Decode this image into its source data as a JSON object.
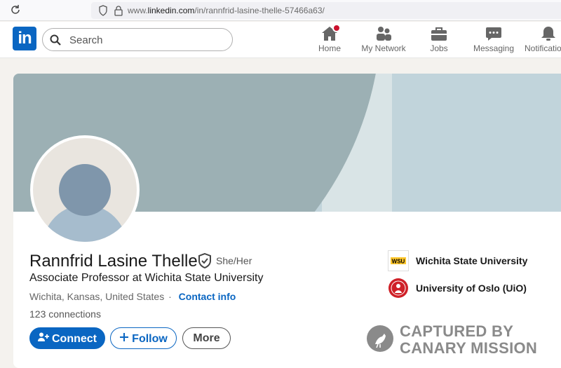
{
  "browser": {
    "url_prefix": "www.",
    "url_domain": "linkedin.com",
    "url_path": "/in/rannfrid-lasine-thelle-57466a63/"
  },
  "nav": {
    "logo": "in",
    "search_placeholder": "Search",
    "items": [
      {
        "label": "Home",
        "icon": "home-icon"
      },
      {
        "label": "My Network",
        "icon": "network-icon"
      },
      {
        "label": "Jobs",
        "icon": "briefcase-icon"
      },
      {
        "label": "Messaging",
        "icon": "chat-icon"
      },
      {
        "label": "Notifications",
        "icon": "bell-icon"
      }
    ]
  },
  "profile": {
    "name": "Rannfrid Lasine Thelle",
    "pronouns": "She/Her",
    "headline": "Associate Professor at Wichita State University",
    "location": "Wichita, Kansas, United States",
    "separator": "·",
    "contact_info": "Contact info",
    "connections": "123 connections",
    "buttons": {
      "connect": "Connect",
      "follow": "Follow",
      "more": "More"
    },
    "organizations": [
      {
        "name": "Wichita State University",
        "logo": "wsu-shocker-logo",
        "logo_text": "WSU"
      },
      {
        "name": "University of Oslo (UiO)",
        "logo": "uio-seal-logo"
      }
    ]
  },
  "watermark": {
    "line1": "CAPTURED BY",
    "line2": "CANARY MISSION"
  },
  "colors": {
    "brand_blue": "#0a66c2",
    "notification_red": "#cb112d",
    "banner_light": "#c1d4db",
    "banner_dark": "#9cb0b4"
  }
}
